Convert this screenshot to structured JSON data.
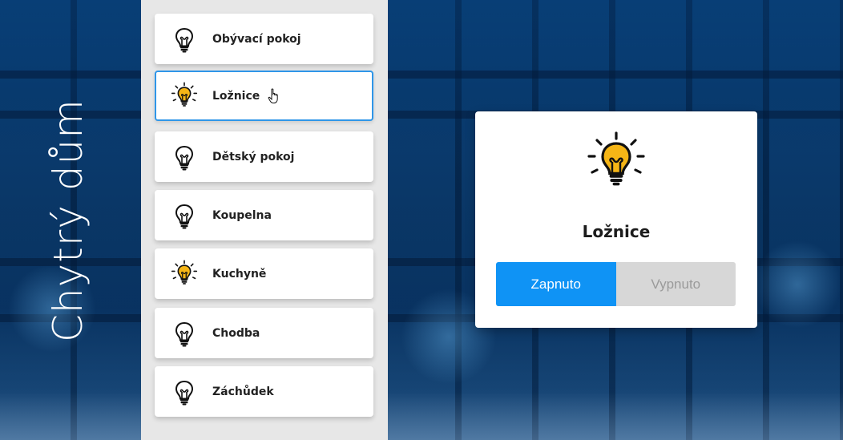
{
  "app": {
    "title": "Chytrý dům"
  },
  "rooms": [
    {
      "label": "Obývací pokoj",
      "light": "off",
      "icon": "bulb-off-icon"
    },
    {
      "label": "Ložnice",
      "light": "on",
      "icon": "bulb-on-icon"
    },
    {
      "label": "Dětský pokoj",
      "light": "off",
      "icon": "bulb-off-icon"
    },
    {
      "label": "Koupelna",
      "light": "off",
      "icon": "bulb-off-icon"
    },
    {
      "label": "Kuchyně",
      "light": "on",
      "icon": "bulb-on-icon"
    },
    {
      "label": "Chodba",
      "light": "off",
      "icon": "bulb-off-icon"
    },
    {
      "label": "Záchůdek",
      "light": "off",
      "icon": "bulb-off-icon"
    }
  ],
  "detail": {
    "room_title": "Ložnice",
    "on_label": "Zapnuto",
    "off_label": "Vypnuto",
    "state": "on"
  },
  "colors": {
    "accent": "#0f93f5",
    "selected_border": "#2f96e8",
    "bulb_on": "#f5b516",
    "sidebar_bg": "#e7e7e7",
    "toggle_off_bg": "#d7d7d7"
  }
}
